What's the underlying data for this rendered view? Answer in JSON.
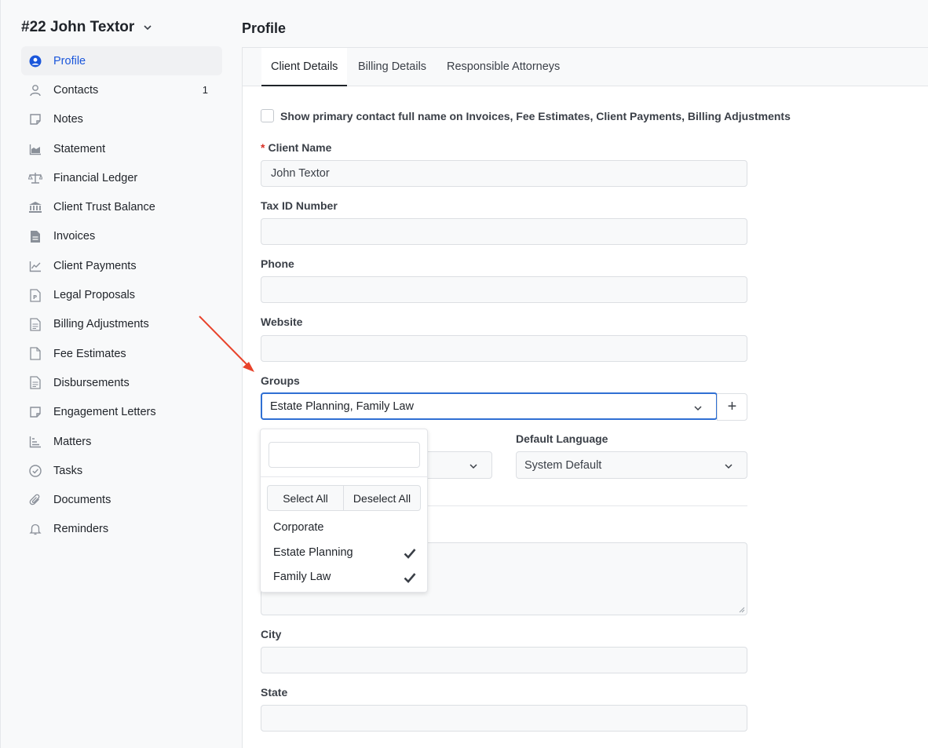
{
  "client": {
    "title": "#22 John Textor"
  },
  "sidebar": {
    "items": [
      {
        "label": "Profile",
        "icon": "user-circle-icon",
        "active": true
      },
      {
        "label": "Contacts",
        "icon": "person-icon",
        "count": "1"
      },
      {
        "label": "Notes",
        "icon": "note-icon"
      },
      {
        "label": "Statement",
        "icon": "area-chart-icon"
      },
      {
        "label": "Financial Ledger",
        "icon": "scale-icon"
      },
      {
        "label": "Client Trust Balance",
        "icon": "bank-icon"
      },
      {
        "label": "Invoices",
        "icon": "invoice-icon"
      },
      {
        "label": "Client Payments",
        "icon": "line-chart-icon"
      },
      {
        "label": "Legal Proposals",
        "icon": "proposal-icon"
      },
      {
        "label": "Billing Adjustments",
        "icon": "document-icon"
      },
      {
        "label": "Fee Estimates",
        "icon": "file-icon"
      },
      {
        "label": "Disbursements",
        "icon": "document-icon"
      },
      {
        "label": "Engagement Letters",
        "icon": "note-icon"
      },
      {
        "label": "Matters",
        "icon": "bar-chart-icon"
      },
      {
        "label": "Tasks",
        "icon": "check-circle-icon"
      },
      {
        "label": "Documents",
        "icon": "paperclip-icon"
      },
      {
        "label": "Reminders",
        "icon": "bell-icon"
      }
    ]
  },
  "main": {
    "title": "Profile",
    "tabs": [
      {
        "label": "Client Details",
        "active": true
      },
      {
        "label": "Billing Details"
      },
      {
        "label": "Responsible Attorneys"
      }
    ],
    "show_primary_contact_label": "Show primary contact full name on Invoices, Fee Estimates, Client Payments, Billing Adjustments",
    "fields": {
      "client_name": {
        "label": "Client Name",
        "required_mark": "*",
        "value": "John Textor"
      },
      "tax_id": {
        "label": "Tax ID Number",
        "value": ""
      },
      "phone": {
        "label": "Phone",
        "value": ""
      },
      "website": {
        "label": "Website",
        "value": ""
      },
      "groups": {
        "label": "Groups",
        "value": "Estate Planning, Family Law",
        "add_label": "+"
      },
      "default_language": {
        "label": "Default Language",
        "value": "System Default"
      },
      "city": {
        "label": "City",
        "value": ""
      },
      "state": {
        "label": "State",
        "value": ""
      }
    }
  },
  "groups_dropdown": {
    "search_value": "",
    "select_all_label": "Select All",
    "deselect_all_label": "Deselect All",
    "options": [
      {
        "label": "Corporate",
        "checked": false
      },
      {
        "label": "Estate Planning",
        "checked": true
      },
      {
        "label": "Family Law",
        "checked": true
      }
    ]
  },
  "colors": {
    "accent": "#1a56db",
    "focus_border": "#2f6fd3",
    "annotation_arrow": "#e8432b",
    "required": "#d93025"
  }
}
